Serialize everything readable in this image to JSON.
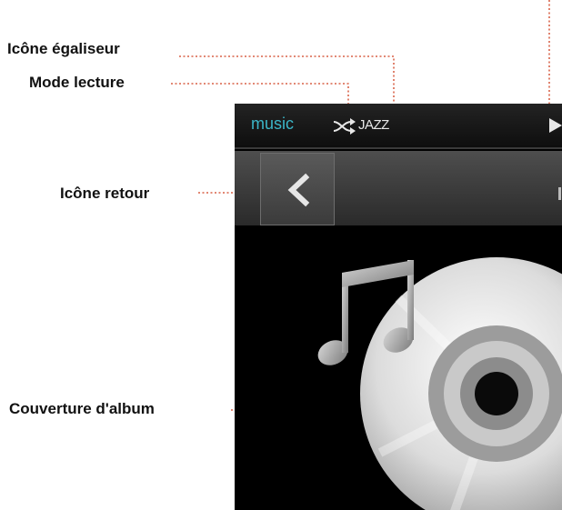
{
  "callouts": {
    "equalizer": "Icône égaliseur",
    "play_mode": "Mode lecture",
    "back": "Icône retour",
    "album_cover": "Couverture d'album"
  },
  "status_bar": {
    "app_name": "music",
    "shuffle_icon": "shuffle-icon",
    "equalizer_label": "JAZZ",
    "play_icon": "play-icon"
  },
  "toolbar": {
    "back_icon": "chevron-left-icon"
  },
  "album": {
    "art_icon": "music-cd-icon"
  },
  "colors": {
    "app_name": "#3bb6c8",
    "leader_line": "#d04020",
    "device_bg": "#000000"
  }
}
